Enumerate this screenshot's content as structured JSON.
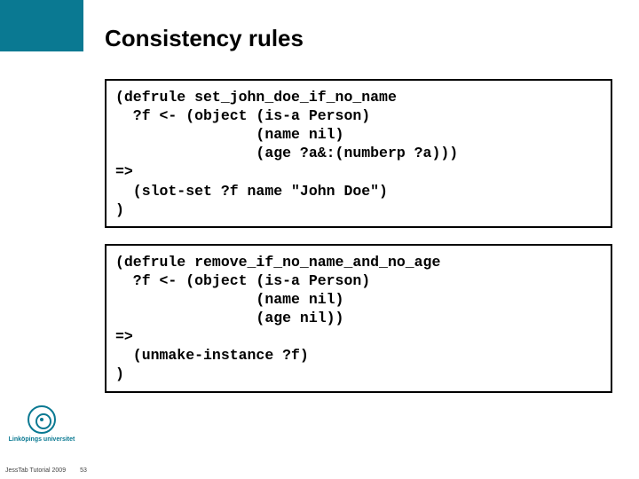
{
  "title": "Consistency rules",
  "code1": "(defrule set_john_doe_if_no_name\n  ?f <- (object (is-a Person)\n                (name nil)\n                (age ?a&:(numberp ?a)))\n=>\n  (slot-set ?f name \"John Doe\")\n)",
  "code2": "(defrule remove_if_no_name_and_no_age\n  ?f <- (object (is-a Person)\n                (name nil)\n                (age nil))\n=>\n  (unmake-instance ?f)\n)",
  "university": "Linköpings universitet",
  "footer_text": "JessTab Tutorial 2009",
  "slide_number": "53"
}
